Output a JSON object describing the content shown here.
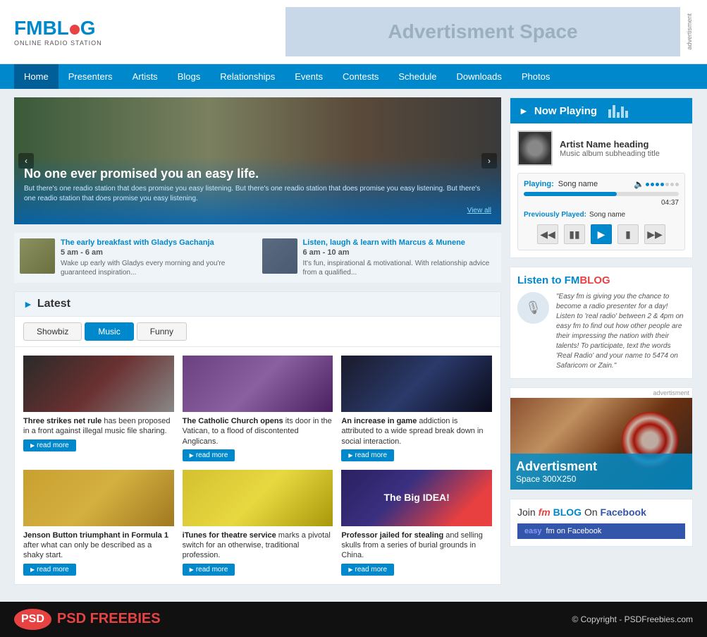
{
  "header": {
    "logo_main": "FMBLOG",
    "logo_accent": "FM",
    "logo_sub": "ONLINE RADIO STATION",
    "ad_text": "Advertisment Space"
  },
  "nav": {
    "items": [
      {
        "label": "Home",
        "active": true
      },
      {
        "label": "Presenters",
        "active": false
      },
      {
        "label": "Artists",
        "active": false
      },
      {
        "label": "Blogs",
        "active": false
      },
      {
        "label": "Relationships",
        "active": false
      },
      {
        "label": "Events",
        "active": false
      },
      {
        "label": "Contests",
        "active": false
      },
      {
        "label": "Schedule",
        "active": false
      },
      {
        "label": "Downloads",
        "active": false
      },
      {
        "label": "Photos",
        "active": false
      }
    ]
  },
  "hero": {
    "title": "No one ever promised you an easy life.",
    "description": "But there's one readio station that does promise you easy listening. But there's one readio station that does promise you easy listening. But there's one readio station that does promise you easy listening.",
    "view_all": "View all"
  },
  "shows": [
    {
      "title": "The early breakfast with Gladys Gachanja",
      "time": "5 am - 6 am",
      "desc": "Wake up early with Gladys every morning and you're guaranteed inspiration..."
    },
    {
      "title": "Listen, laugh & learn with Marcus & Munene",
      "time": "6 am - 10 am",
      "desc": "It's fun, inspirational & motivational. With relationship advice from a qualified..."
    }
  ],
  "latest": {
    "section_title": "Latest",
    "tabs": [
      "Showbiz",
      "Music",
      "Funny"
    ],
    "active_tab": 1,
    "articles": [
      {
        "title_bold": "Three strikes net rule",
        "title_rest": " has been proposed in a front against illegal music file sharing.",
        "desc": "",
        "read_more": "read more"
      },
      {
        "title_bold": "The Catholic Church opens",
        "title_rest": " its door in the Vatican, to a flood of discontented Anglicans.",
        "desc": "",
        "read_more": "read more"
      },
      {
        "title_bold": "An increase in game",
        "title_rest": " addiction is attributed to a wide spread break down in social interaction.",
        "desc": "",
        "read_more": "read more"
      },
      {
        "title_bold": "Jenson Button triumphant in Formula 1",
        "title_rest": " after what can only be described as a shaky start.",
        "desc": "",
        "read_more": "read more"
      },
      {
        "title_bold": "iTunes for theatre service",
        "title_rest": " marks a pivotal switch for an otherwise, traditional profession.",
        "desc": "",
        "read_more": "read more"
      },
      {
        "title_bold": "Professor jailed for stealing",
        "title_rest": " and selling skulls from a series of burial grounds in China.",
        "desc": "",
        "read_more": "read more"
      }
    ]
  },
  "now_playing": {
    "title": "Now Playing",
    "artist": "Artist Name heading",
    "album": "Music album subheading title",
    "playing_label": "Playing:",
    "song_name": "Song name",
    "time": "04:37",
    "prev_played_label": "Previously Played:",
    "prev_song": "Song name"
  },
  "listen": {
    "title_start": "Listen to ",
    "brand": "FMBLOG",
    "text": "\"Easy fm is giving you the chance to become a radio presenter for a day! Listen to 'real radio' between 2 & 4pm on easy fm to find out how other people are their impressing the nation with their talents! To participate, text the words 'Real Radio' and your name to 5474 on Safaricom or Zain.\""
  },
  "ad": {
    "label": "advertisment",
    "overlay_title": "Advertisment",
    "overlay_sub": "Space 300X250"
  },
  "facebook": {
    "title_join": "Join ",
    "title_fm": "fm",
    "title_blog": " BLOG",
    "title_on": " On ",
    "title_fb": "Facebook",
    "link_text_easy": "easy",
    "link_text_rest": " fm on Facebook"
  },
  "footer": {
    "psd": "PSD",
    "freebies": " FREEBIES",
    "copyright": "© Copyright - PSDFreebies.com"
  }
}
